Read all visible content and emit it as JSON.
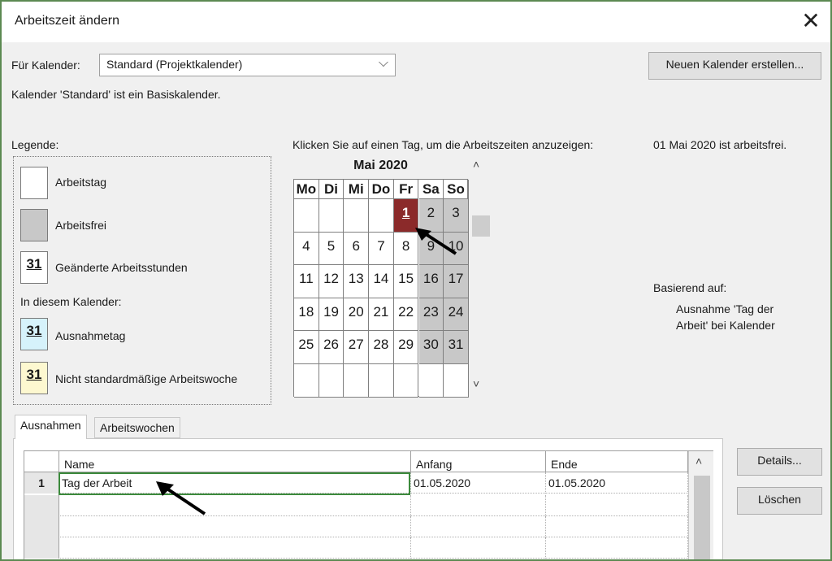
{
  "dialog": {
    "title": "Arbeitszeit ändern",
    "close_glyph": "✕"
  },
  "calendar_selector": {
    "label": "Für Kalender:",
    "value": "Standard (Projektkalender)",
    "arrow": "⌵"
  },
  "new_calendar_button": "Neuen Kalender erstellen...",
  "base_calendar_note": "Kalender 'Standard' ist ein Basiskalender.",
  "legend": {
    "title": "Legende:",
    "items": [
      {
        "label": "Arbeitstag",
        "swatch": ""
      },
      {
        "label": "Arbeitsfrei",
        "swatch": ""
      },
      {
        "label": "Geänderte Arbeitsstunden",
        "swatch": "31"
      }
    ],
    "subheading": "In diesem Kalender:",
    "items2": [
      {
        "label": "Ausnahmetag",
        "swatch": "31"
      },
      {
        "label": "Nicht standardmäßige Arbeitswoche",
        "swatch": "31"
      }
    ]
  },
  "calendar": {
    "instruction": "Klicken Sie auf einen Tag, um die Arbeitszeiten anzuzeigen:",
    "month": "Mai 2020",
    "weekdays": [
      "Mo",
      "Di",
      "Mi",
      "Do",
      "Fr",
      "Sa",
      "So"
    ],
    "weeks": [
      [
        "",
        "",
        "",
        "",
        "1",
        "2",
        "3"
      ],
      [
        "4",
        "5",
        "6",
        "7",
        "8",
        "9",
        "10"
      ],
      [
        "11",
        "12",
        "13",
        "14",
        "15",
        "16",
        "17"
      ],
      [
        "18",
        "19",
        "20",
        "21",
        "22",
        "23",
        "24"
      ],
      [
        "25",
        "26",
        "27",
        "28",
        "29",
        "30",
        "31"
      ],
      [
        "",
        "",
        "",
        "",
        "",
        "",
        ""
      ]
    ],
    "selected_day": "1",
    "scroll_up": "˄",
    "scroll_down": "˅"
  },
  "info": {
    "status": "01 Mai 2020 ist arbeitsfrei.",
    "based_on_label": "Basierend auf:",
    "based_on_line1": "Ausnahme 'Tag der",
    "based_on_line2": "Arbeit' bei Kalender"
  },
  "tabs": [
    {
      "label": "Ausnahmen",
      "active": true
    },
    {
      "label": "Arbeitswochen",
      "active": false
    }
  ],
  "exceptions_table": {
    "columns": [
      "Name",
      "Anfang",
      "Ende"
    ],
    "rows": [
      {
        "num": "1",
        "name": "Tag der Arbeit",
        "start": "01.05.2020",
        "end": "01.05.2020"
      }
    ],
    "scroll_up": "˄"
  },
  "buttons": {
    "details": "Details...",
    "delete": "Löschen"
  },
  "colors": {
    "selected_day": "#8b2a2a",
    "non_working": "#c8c8c8",
    "exception_swatch": "#d6f2fb",
    "nonstandard_swatch": "#fdf8d0",
    "edit_border": "#3c8a3c"
  }
}
